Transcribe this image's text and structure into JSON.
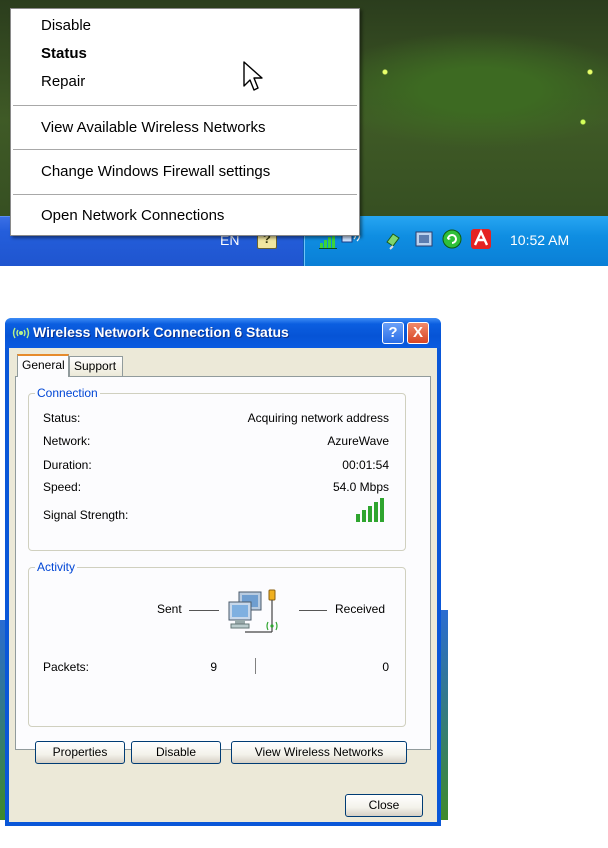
{
  "context_menu": {
    "items": [
      {
        "label": "Disable",
        "bold": false
      },
      {
        "label": "Status",
        "bold": true
      },
      {
        "label": "Repair",
        "bold": false
      },
      {
        "label": "View Available Wireless Networks",
        "bold": false
      },
      {
        "label": "Change Windows Firewall settings",
        "bold": false
      },
      {
        "label": "Open Network Connections",
        "bold": false
      }
    ]
  },
  "taskbar": {
    "language": "EN",
    "clock": "10:52 AM",
    "tray_icons": [
      "wireless-signal-icon",
      "network-activity-icon",
      "safely-remove-icon",
      "media-icon",
      "update-icon",
      "avira-antivirus-icon"
    ]
  },
  "dialog": {
    "title": "Wireless Network Connection 6 Status",
    "title_buttons": {
      "help": "?",
      "close": "X"
    },
    "tabs": [
      {
        "label": "General",
        "active": true
      },
      {
        "label": "Support",
        "active": false
      }
    ],
    "connection": {
      "group_label": "Connection",
      "rows": [
        {
          "label": "Status:",
          "value": "Acquiring network address"
        },
        {
          "label": "Network:",
          "value": "AzureWave"
        },
        {
          "label": "Duration:",
          "value": "00:01:54"
        },
        {
          "label": "Speed:",
          "value": "54.0 Mbps"
        }
      ],
      "signal_label": "Signal Strength:",
      "signal_bars_lit": 5,
      "signal_bars_total": 5
    },
    "activity": {
      "group_label": "Activity",
      "sent_label": "Sent",
      "received_label": "Received",
      "packets_label": "Packets:",
      "packets_sent": "9",
      "packets_received": "0"
    },
    "buttons": {
      "properties": "Properties",
      "disable": "Disable",
      "view_wireless": "View Wireless Networks",
      "close": "Close"
    }
  },
  "colors": {
    "menu_bg": "#ffffff",
    "xp_blue": "#0a57d8",
    "dialog_face": "#ece9d8",
    "group_label": "#0046d5",
    "signal_green": "#2fa52f"
  }
}
